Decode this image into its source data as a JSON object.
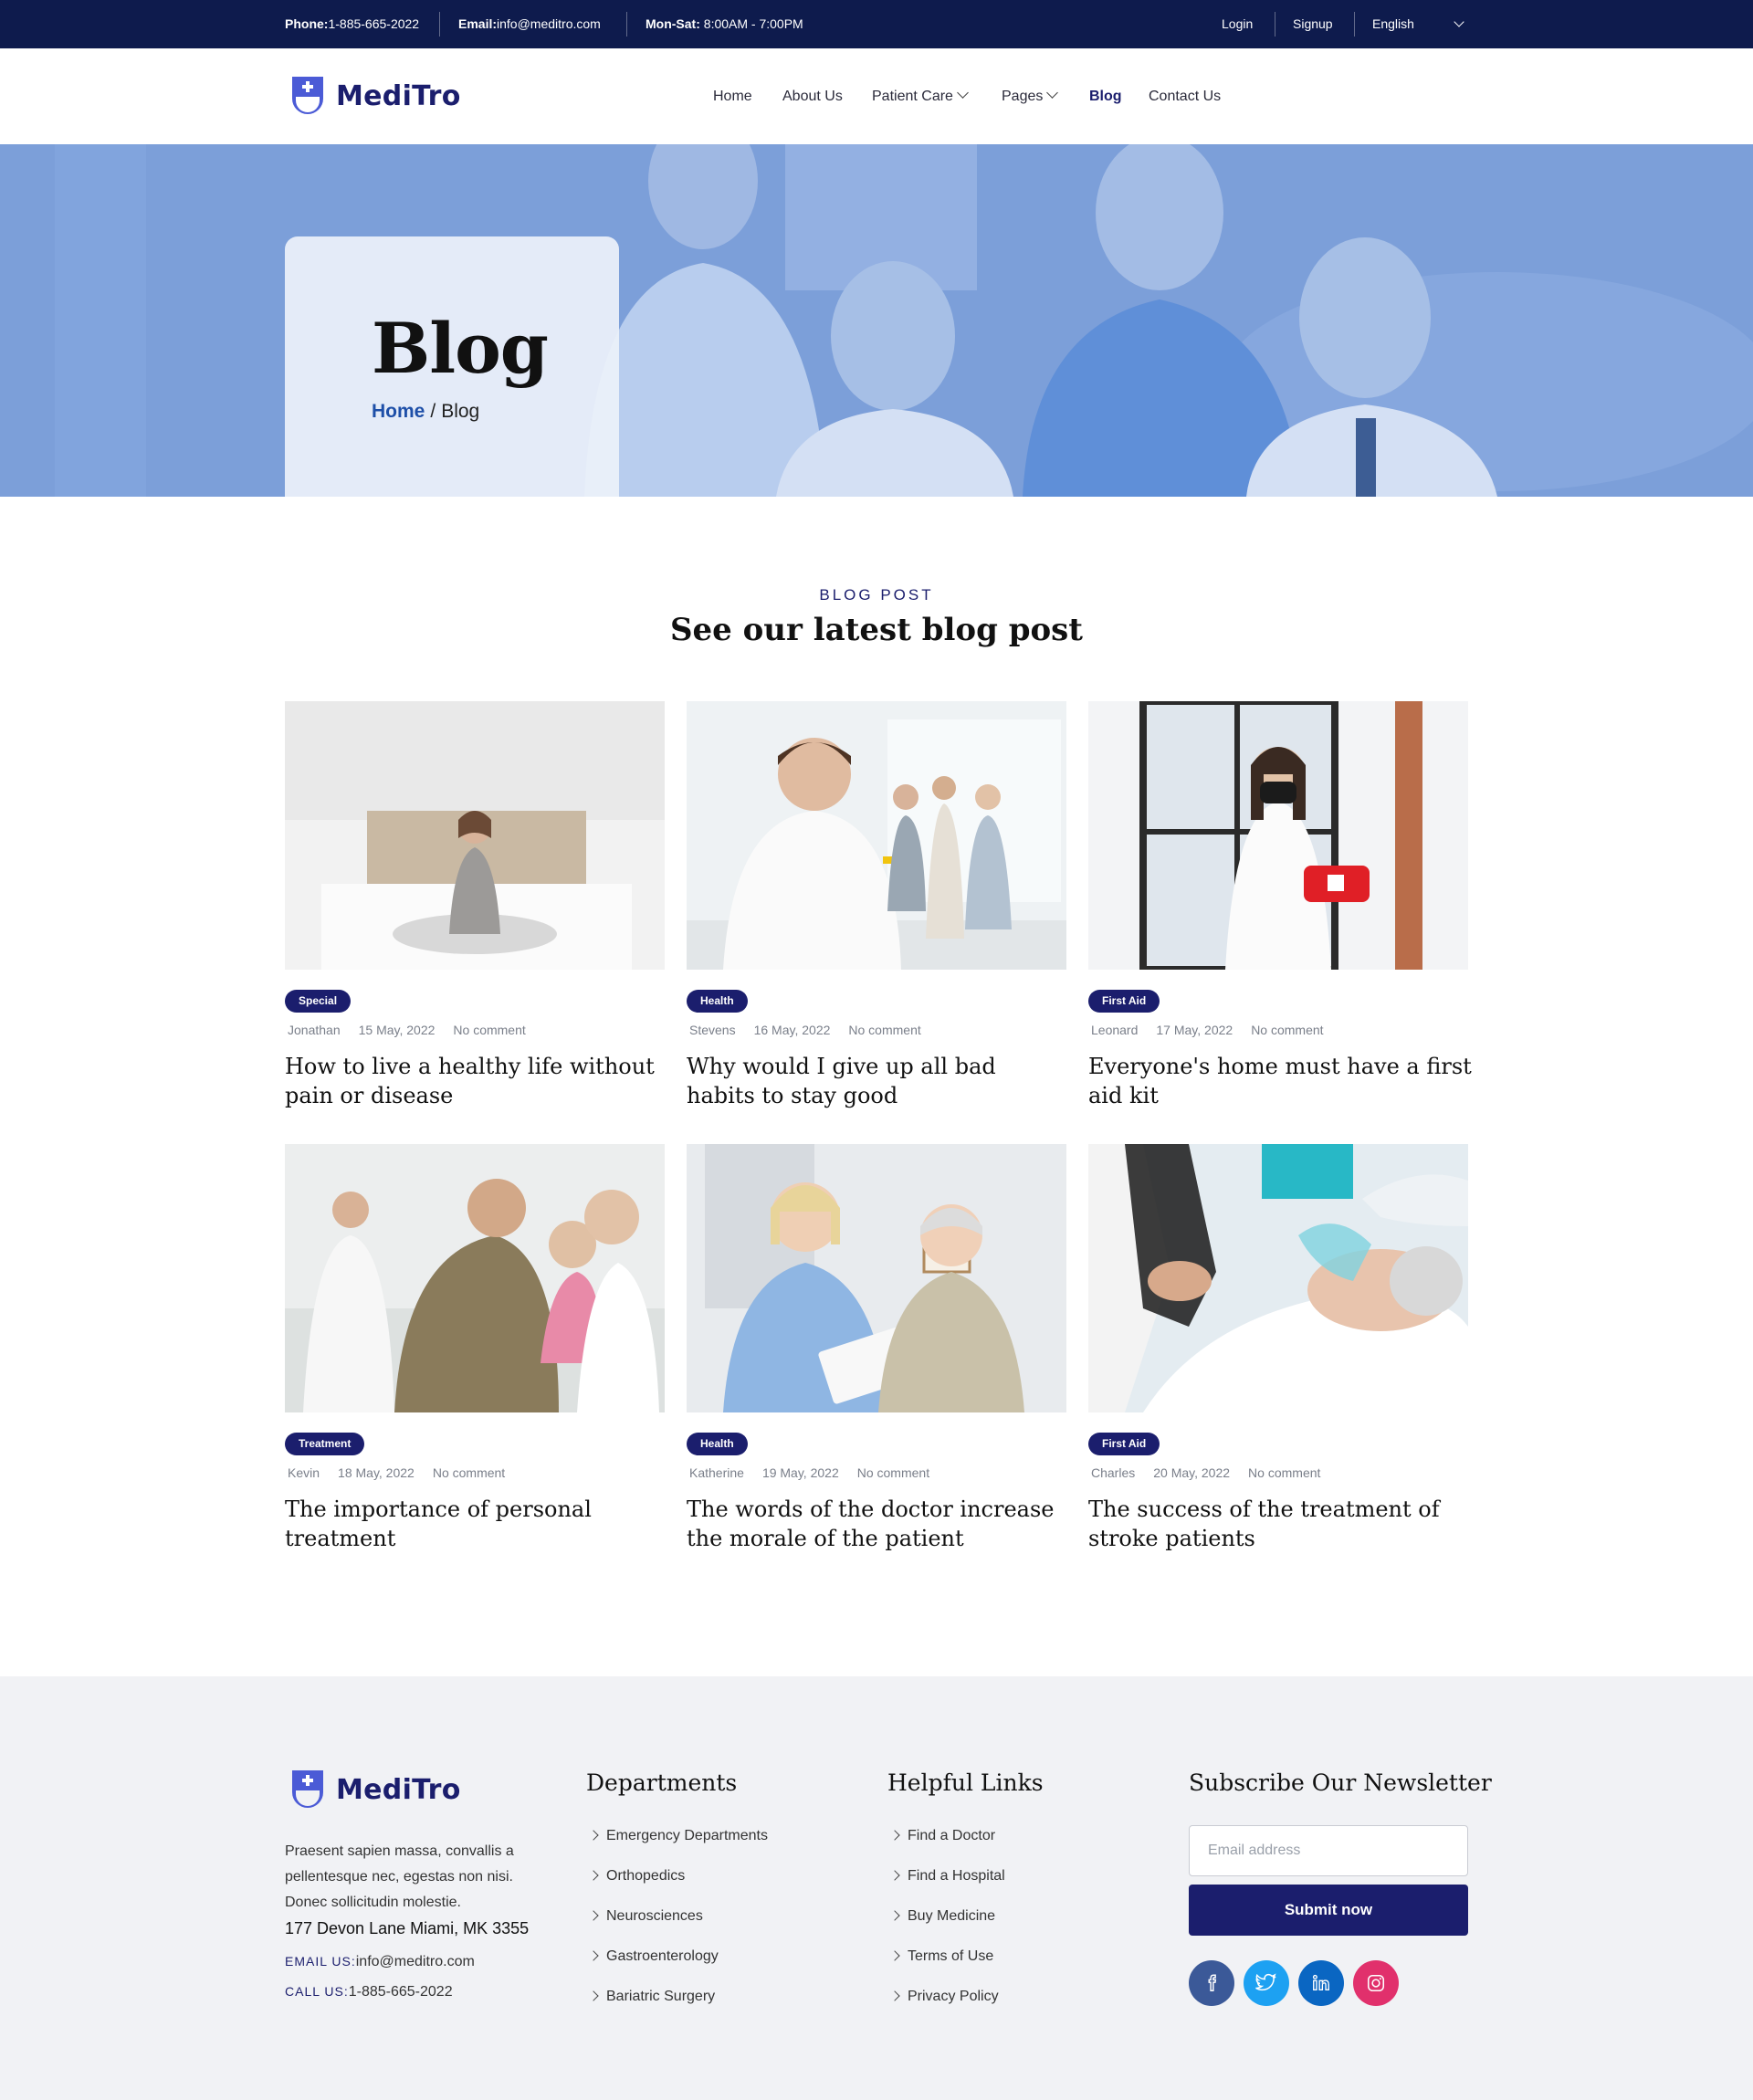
{
  "topbar": {
    "phone_label": "Phone:",
    "phone_value": "1-885-665-2022",
    "email_label": "Email:",
    "email_value": "info@meditro.com",
    "hours_label": "Mon-Sat:",
    "hours_value": "8:00AM - 7:00PM",
    "login": "Login",
    "signup": "Signup",
    "language": "English"
  },
  "brand": {
    "name": "MediTro",
    "color": "#1b1e6d"
  },
  "nav": {
    "home": "Home",
    "about": "About Us",
    "patient_care": "Patient Care",
    "pages": "Pages",
    "blog": "Blog",
    "contact": "Contact Us"
  },
  "hero": {
    "title": "Blog",
    "breadcrumb_home": "Home",
    "breadcrumb_sep": "/",
    "breadcrumb_current": "Blog"
  },
  "section": {
    "eyebrow": "BLOG POST",
    "title": "See our latest blog post"
  },
  "posts": [
    {
      "tag": "Special",
      "author": "Jonathan",
      "date": "15 May, 2022",
      "comments": "No comment",
      "title": "How to live a healthy life without pain or disease"
    },
    {
      "tag": "Health",
      "author": "Stevens",
      "date": "16 May, 2022",
      "comments": "No comment",
      "title": "Why would I give up all bad habits to stay good"
    },
    {
      "tag": "First Aid",
      "author": "Leonard",
      "date": "17 May, 2022",
      "comments": "No comment",
      "title": "Everyone's home must have a first aid kit"
    },
    {
      "tag": "Treatment",
      "author": "Kevin",
      "date": "18 May, 2022",
      "comments": "No comment",
      "title": "The importance of personal treatment"
    },
    {
      "tag": "Health",
      "author": "Katherine",
      "date": "19 May, 2022",
      "comments": "No comment",
      "title": "The words of the doctor increase the morale of the patient"
    },
    {
      "tag": "First Aid",
      "author": "Charles",
      "date": "20 May, 2022",
      "comments": "No comment",
      "title": "The success of the treatment of stroke patients"
    }
  ],
  "footer": {
    "description": "Praesent sapien massa, convallis a pellentesque nec, egestas non nisi. Donec sollicitudin molestie.",
    "address": "177 Devon Lane Miami, MK 3355",
    "email_label": "EMAIL US:",
    "email_value": "info@meditro.com",
    "call_label": "CALL US:",
    "call_value": "1-885-665-2022",
    "departments_title": "Departments",
    "departments": [
      "Emergency Departments",
      "Orthopedics",
      "Neurosciences",
      "Gastroenterology",
      "Bariatric Surgery"
    ],
    "links_title": "Helpful Links",
    "links": [
      "Find a Doctor",
      "Find a Hospital",
      "Buy Medicine",
      "Terms of Use",
      "Privacy Policy"
    ],
    "newsletter_title": "Subscribe Our Newsletter",
    "email_placeholder": "Email address",
    "submit": "Submit now",
    "socials": [
      {
        "icon": "facebook-icon",
        "color": "#3b5998"
      },
      {
        "icon": "twitter-icon",
        "color": "#1da1f2"
      },
      {
        "icon": "linkedin-icon",
        "color": "#0a66c2"
      },
      {
        "icon": "instagram-icon",
        "color": "#e1306c"
      }
    ]
  },
  "colors": {
    "topbar": "#0e1b4d",
    "accent": "#1b1e6d",
    "footer_bg": "#f1f2f5"
  }
}
